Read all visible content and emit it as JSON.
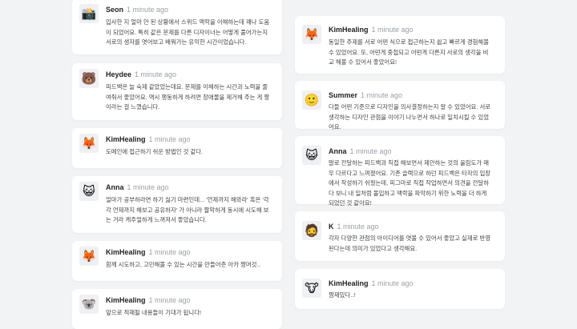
{
  "left_column": [
    {
      "avatar": "camera-icon",
      "glyph": "📸",
      "name": "Seon",
      "time": "1 minute ago",
      "text": "입사한 지 얼마 안 된 상황에서 스위드 맥락을 이해하는데 꽤나 도움이 되었어요. 특히 같은 문제를 다른 디자이너는 어떻게 풀어가는지 서로의 생자를 엿어보고 배워가는 유익한 시간이었습니다."
    },
    {
      "avatar": "polar-bear-icon",
      "glyph": "🐻",
      "name": "Heydee",
      "time": "1 minute ago",
      "text": "피드백은 늘 숙제 같았었는데요. 문제를 이해하는 시간과 노력을 줄여줘서 좋았어요. 역시 행동하게 하려면 장애물을 제거해 주는 게 짱이라는 걸 느꼈습니다."
    },
    {
      "avatar": "fox-icon",
      "glyph": "🦊",
      "name": "KimHealing",
      "time": "1 minute ago",
      "text": "도메인에 접근하기 쉬운 방법인 것 같다."
    },
    {
      "avatar": "cat-icon",
      "glyph": "😺",
      "name": "Anna",
      "time": "1 minute ago",
      "text": "얼마가 공부하라면 하기 싫기 마련인데... '언제까지 해와라' 혹은 '각각 언제까지 해보고 공유하자' 가 아니라 짤막하게 동시에 시도해 보는 거라 케주얼하게 느껴져서 좋았습니다."
    },
    {
      "avatar": "fox-icon",
      "glyph": "🦊",
      "name": "KimHealing",
      "time": "1 minute ago",
      "text": "함께 시도하고, 고민해볼 수 있는 시간을 만들어준 아카 짱머것.."
    },
    {
      "avatar": "koala-icon",
      "glyph": "🐨",
      "name": "KimHealing",
      "time": "1 minute ago",
      "text": "앞으로 적재될 내용들이 기대가 됩니다!"
    }
  ],
  "right_column": [
    {
      "avatar": "fox-icon",
      "glyph": "🦊",
      "name": "KimHealing",
      "time": "1 minute ago",
      "text": "동일한 주제를 서로 어떤 식으로 접근하는지 쉽고 빠르게 경험해볼 수 있었어요. 또, 어떤게 중첩되고 어떤게 다른지 서로의 생각을 비교 해볼 수 있어서 좋았어요!"
    },
    {
      "avatar": "smile-face-icon",
      "glyph": "🙂",
      "name": "Summer",
      "time": "1 minute ago",
      "text": "다들 어떤 기준으로 디자인을 의사결정하는지 알 수 있었어요. 서로 생각하는 디자인 관점을 이야기 나누면서 하나로 일치시킬 수 있었어요."
    },
    {
      "avatar": "cat-icon",
      "glyph": "😺",
      "name": "Anna",
      "time": "1 minute ago",
      "text": "말로 전달하는 피드백과 직접 해보면서 제안하는 것의 울림도가 매우 다르다고 느껴졌어요. 기존 슬랙으로 하던 피드백은 타자의 입장에서 작성하기 쉬웠는데, 피그마로 직접 작업하면서 의견을 전달하다 보니 내 일처럼 몰입하고 맥락을 파악하기 위한 노력을 더 하게 되었던 것 같아요!"
    },
    {
      "avatar": "man-face-icon",
      "glyph": "🧔",
      "name": "K",
      "time": "1 minute ago",
      "text": "각자 다양한 관점의 아이디어를 엿볼 수 있어서 좋았고 실제로 반영된다는데 의미가 있었다고 생각해요."
    },
    {
      "avatar": "cow-icon",
      "glyph": "🐮",
      "name": "KimHealing",
      "time": "1 minute ago",
      "text": "짱재밌다..!"
    }
  ]
}
